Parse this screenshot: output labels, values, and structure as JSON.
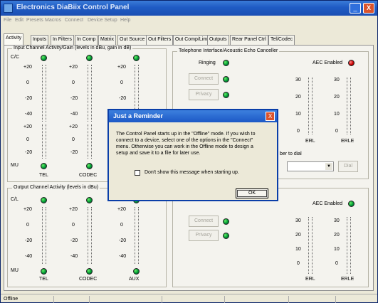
{
  "window": {
    "title": "Electronics DiaBiix Control Panel",
    "min_label": "_",
    "close_label": "X"
  },
  "menu": [
    "File",
    "Edit",
    "Presets",
    "Macros",
    "Connect",
    "Device Setup",
    "Help"
  ],
  "tabs": [
    "Activity",
    "Inputs",
    "In Filters",
    "In Comp",
    "Matrix",
    "Out Source",
    "Out Filters",
    "Out Comp/Lim",
    "Outputs",
    "Rear Panel Ctrl",
    "Tel/Codec"
  ],
  "input_group": {
    "title": "Input Channel Activity/Gain (levels in dBu, gain in dB)",
    "cc_label": "C/C",
    "mu_label": "MU",
    "scale_1": [
      "+20",
      "0",
      "-20",
      "-40"
    ],
    "scale_2": [
      "+20",
      "0",
      "-20"
    ],
    "channels": [
      "TEL",
      "CODEC"
    ]
  },
  "output_group": {
    "title": "Output Channel Activity (levels in dBu)",
    "cl_label": "C/L",
    "mu_label": "MU",
    "scale": [
      "+20",
      "0",
      "-20",
      "-40"
    ],
    "channels": [
      "TEL",
      "CODEC",
      "AUX"
    ]
  },
  "tel_group": {
    "title": "Telephone Interface/Acoustic Echo Canceller",
    "ringing_label": "Ringing",
    "connect_label": "Connect",
    "privacy_label": "Privacy",
    "aec_label": "AEC Enabled",
    "dial_label": "ber to dial",
    "dial_button": "Dial",
    "erl_scale": [
      "30",
      "20",
      "10",
      "0"
    ],
    "erle_scale": [
      "30",
      "20",
      "10",
      "0"
    ],
    "erl_label": "ERL",
    "erle_label": "ERLE"
  },
  "codec_group": {
    "aec_label": "AEC Enabled",
    "connect_label": "Connect",
    "privacy_label": "Privacy",
    "erl_scale": [
      "30",
      "20",
      "10",
      "0"
    ],
    "erle_scale": [
      "30",
      "20",
      "10",
      "0"
    ],
    "erl_label": "ERL",
    "erle_label": "ERLE"
  },
  "dialog": {
    "title": "Just a Reminder",
    "close_label": "X",
    "line1": "The Control Panel starts up in the \"Offline\" mode. If you wish to",
    "line2": "connect to a device, select one of the options in the \"Connect\"",
    "line3": "menu. Otherwise you can work in the Offline mode to design a",
    "line4": "setup and save it to a file for later use.",
    "checkbox_label": "Don't show this message when starting up.",
    "ok_label": "OK"
  },
  "status": {
    "text": "Offline"
  },
  "colors": {
    "titlebar": "#1f5bc4",
    "led_green": "#009933",
    "led_red": "#cc0000",
    "dialog_close": "#d9532c"
  }
}
